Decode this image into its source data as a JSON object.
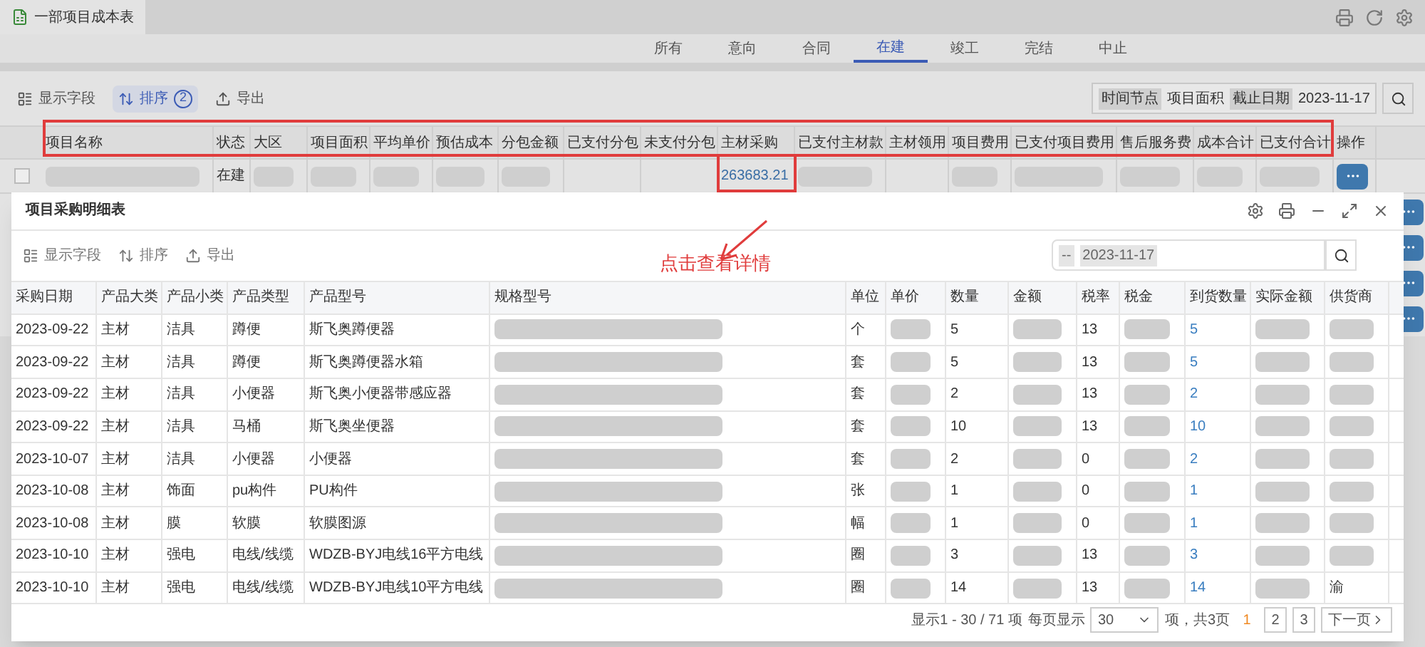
{
  "window": {
    "title": "一部项目成本表"
  },
  "tabs": [
    {
      "label": "所有",
      "selected": false
    },
    {
      "label": "意向",
      "selected": false
    },
    {
      "label": "合同",
      "selected": false
    },
    {
      "label": "在建",
      "selected": true
    },
    {
      "label": "竣工",
      "selected": false
    },
    {
      "label": "完结",
      "selected": false
    },
    {
      "label": "中止",
      "selected": false
    }
  ],
  "toolbar": {
    "fields": "显示字段",
    "sort": "排序",
    "sort_count": "2",
    "sort_on": true,
    "export": "导出"
  },
  "filter": {
    "node": "时间节点",
    "area": "项目面积",
    "date_label": "截止日期",
    "date": "2023-11-17"
  },
  "table": {
    "columns": [
      "项目名称",
      "状态",
      "大区",
      "项目面积",
      "平均单价",
      "预估成本",
      "分包金额",
      "已支付分包",
      "未支付分包",
      "主材采购",
      "已支付主材款",
      "主材领用",
      "项目费用",
      "已支付项目费用",
      "售后服务费",
      "成本合计",
      "已支付合计",
      "操作"
    ],
    "rows": [
      {
        "checked": false,
        "status": "在建",
        "material": "263683.21"
      }
    ]
  },
  "dialog": {
    "title": "项目采购明细表",
    "toolbar": {
      "fields": "显示字段",
      "sort": "排序",
      "export": "导出"
    },
    "annotation": "点击查看详情",
    "date_prefix": "--",
    "date": "2023-11-17",
    "columns": [
      "采购日期",
      "产品大类",
      "产品小类",
      "产品类型",
      "产品型号",
      "规格型号",
      "单位",
      "单价",
      "数量",
      "金额",
      "税率",
      "税金",
      "到货数量",
      "实际金额",
      "供货商"
    ],
    "rows": [
      {
        "date": "2023-09-22",
        "cat": "主材",
        "sub": "洁具",
        "type": "蹲便",
        "model": "斯飞奥蹲便器",
        "unit": "个",
        "qty": "5",
        "tax": "13",
        "arrived": "5"
      },
      {
        "date": "2023-09-22",
        "cat": "主材",
        "sub": "洁具",
        "type": "蹲便",
        "model": "斯飞奥蹲便器水箱",
        "unit": "套",
        "qty": "5",
        "tax": "13",
        "arrived": "5"
      },
      {
        "date": "2023-09-22",
        "cat": "主材",
        "sub": "洁具",
        "type": "小便器",
        "model": "斯飞奥小便器带感应器",
        "unit": "套",
        "qty": "2",
        "tax": "13",
        "arrived": "2"
      },
      {
        "date": "2023-09-22",
        "cat": "主材",
        "sub": "洁具",
        "type": "马桶",
        "model": "斯飞奥坐便器",
        "unit": "套",
        "qty": "10",
        "tax": "13",
        "arrived": "10"
      },
      {
        "date": "2023-10-07",
        "cat": "主材",
        "sub": "洁具",
        "type": "小便器",
        "model": "小便器",
        "unit": "套",
        "qty": "2",
        "tax": "0",
        "arrived": "2"
      },
      {
        "date": "2023-10-08",
        "cat": "主材",
        "sub": "饰面",
        "type": "pu构件",
        "model": "PU构件",
        "unit": "张",
        "qty": "1",
        "tax": "0",
        "arrived": "1"
      },
      {
        "date": "2023-10-08",
        "cat": "主材",
        "sub": "膜",
        "type": "软膜",
        "model": "软膜图源",
        "unit": "幅",
        "qty": "1",
        "tax": "0",
        "arrived": "1"
      },
      {
        "date": "2023-10-10",
        "cat": "主材",
        "sub": "强电",
        "type": "电线/线缆",
        "model": "WDZB-BYJ电线16平方电线",
        "unit": "圈",
        "qty": "3",
        "tax": "13",
        "arrived": "3"
      },
      {
        "date": "2023-10-10",
        "cat": "主材",
        "sub": "强电",
        "type": "电线/线缆",
        "model": "WDZB-BYJ电线10平方电线",
        "unit": "圈",
        "qty": "14",
        "tax": "13",
        "arrived": "14",
        "supplier": "渝"
      }
    ],
    "pagination": {
      "summary": "显示1 - 30 / 71 项",
      "per_page_label": "每页显示",
      "per_page": "30",
      "total": "项，共3页",
      "pages": [
        {
          "label": "1",
          "selected": true
        },
        {
          "label": "2",
          "selected": false
        },
        {
          "label": "3",
          "selected": false
        }
      ],
      "next": "下一页"
    }
  }
}
